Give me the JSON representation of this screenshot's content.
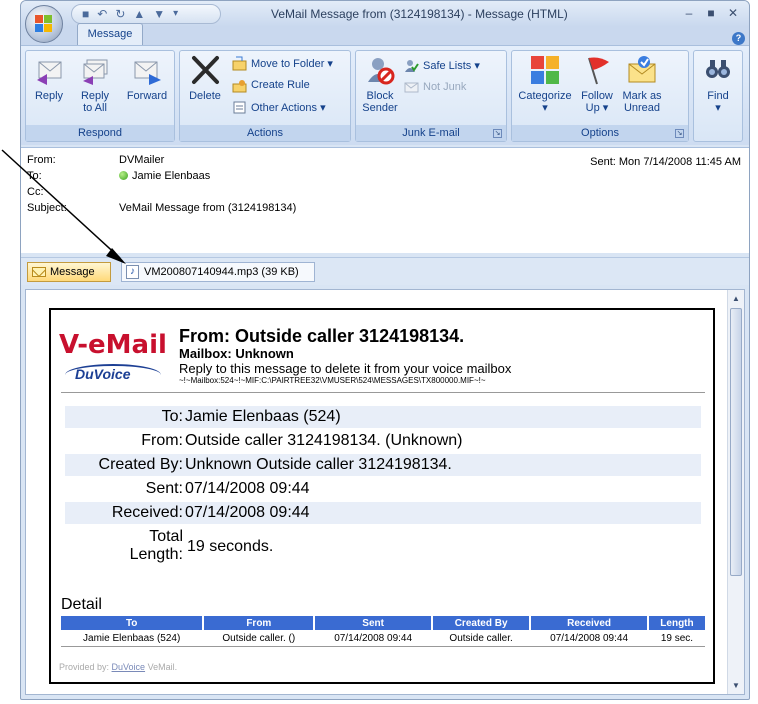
{
  "window": {
    "title": "VeMail Message from  (3124198134) - Message (HTML)",
    "tabs": [
      {
        "label": "Message"
      }
    ]
  },
  "ribbon": {
    "groups": {
      "respond": {
        "label": "Respond",
        "reply": "Reply",
        "reply_all_1": "Reply",
        "reply_all_2": "to All",
        "forward": "Forward"
      },
      "actions": {
        "label": "Actions",
        "delete": "Delete",
        "move_to_folder": "Move to Folder ▾",
        "create_rule": "Create Rule",
        "other_actions": "Other Actions ▾"
      },
      "junk": {
        "label": "Junk E-mail",
        "block_1": "Block",
        "block_2": "Sender",
        "safe_lists": "Safe Lists ▾",
        "not_junk": "Not Junk"
      },
      "options": {
        "label": "Options",
        "categorize_1": "Categorize",
        "categorize_2": "▾",
        "follow_1": "Follow",
        "follow_2": "Up ▾",
        "mark_1": "Mark as",
        "mark_2": "Unread"
      },
      "find": {
        "label_1": "Find",
        "label_2": "▾"
      }
    }
  },
  "headers": {
    "from_label": "From:",
    "from_value": "DVMailer",
    "to_label": "To:",
    "to_value": "Jamie Elenbaas",
    "cc_label": "Cc:",
    "subject_label": "Subject:",
    "subject_value": "VeMail Message from  (3124198134)",
    "sent": "Sent:   Mon 7/14/2008 11:45 AM"
  },
  "attachments": {
    "message": "Message",
    "file": "VM200807140944.mp3 (39 KB)"
  },
  "vemail": {
    "logo_text": "V-eMail",
    "logo_brand": "DuVoice",
    "from": "From: Outside caller 3124198134.",
    "mailbox": "Mailbox: Unknown",
    "reply_note": "Reply to this message to delete it from your voice mailbox",
    "path": "~!~Mailbox:524~!~MIF:C:\\PAIRTREE32\\VMUSER\\524\\MESSAGES\\TX800000.MIF~!~",
    "info": [
      {
        "label": "To:",
        "value": "Jamie Elenbaas (524)"
      },
      {
        "label": "From:",
        "value": "Outside caller 3124198134. (Unknown)"
      },
      {
        "label": "Created By:",
        "value": "Unknown Outside caller 3124198134."
      },
      {
        "label": "Sent:",
        "value": "07/14/2008 09:44"
      },
      {
        "label": "Received:",
        "value": "07/14/2008 09:44"
      }
    ],
    "total_label_1": "Total",
    "total_label_2": "Length:",
    "total_value": "19 seconds.",
    "detail_title": "Detail",
    "detail_columns": [
      "To",
      "From",
      "Sent",
      "Created By",
      "Received",
      "Length"
    ],
    "detail_row": [
      "Jamie Elenbaas (524)",
      "Outside caller. ()",
      "07/14/2008 09:44",
      "Outside caller.",
      "07/14/2008 09:44",
      "19 sec."
    ],
    "provided_prefix": "Provided by: ",
    "provided_link": "DuVoice",
    "provided_suffix": " VeMail."
  },
  "colors": {
    "ribbon_text": "#15428b",
    "table_header": "#3a6bd2",
    "logo_red": "#c8102e",
    "logo_blue": "#1c3f94"
  }
}
